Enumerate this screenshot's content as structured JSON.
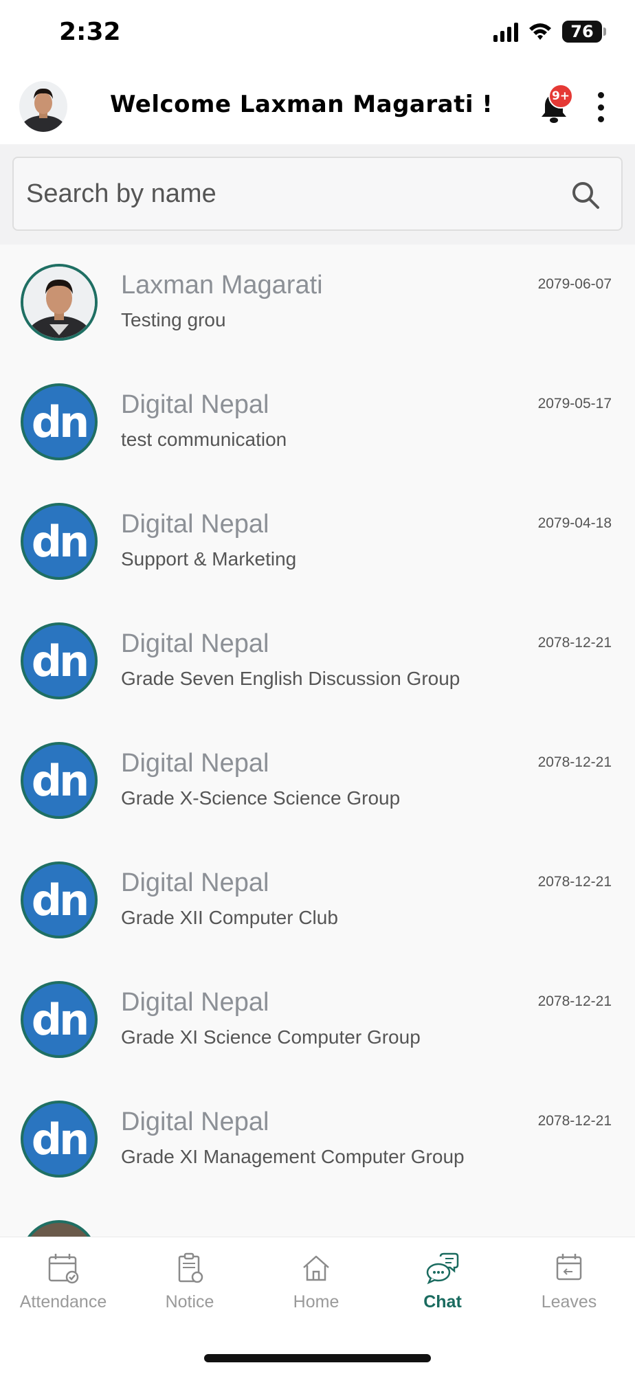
{
  "status_bar": {
    "time": "2:32",
    "battery": "76"
  },
  "header": {
    "welcome_text": "Welcome Laxman Magarati !",
    "notification_badge": "9+"
  },
  "search": {
    "placeholder": "Search by name"
  },
  "colors": {
    "accent": "#1a6b5f",
    "dn_blue": "#2a75c0",
    "badge_red": "#e53935"
  },
  "chats": [
    {
      "name": "Laxman Magarati",
      "message": "Testing grou",
      "date": "2079-06-07",
      "avatar": "photo"
    },
    {
      "name": "Digital Nepal",
      "message": "test communication",
      "date": "2079-05-17",
      "avatar": "dn"
    },
    {
      "name": "Digital Nepal",
      "message": "Support & Marketing",
      "date": "2079-04-18",
      "avatar": "dn"
    },
    {
      "name": "Digital Nepal",
      "message": "Grade Seven English Discussion Group",
      "date": "2078-12-21",
      "avatar": "dn"
    },
    {
      "name": "Digital Nepal",
      "message": "Grade X-Science Science Group",
      "date": "2078-12-21",
      "avatar": "dn"
    },
    {
      "name": "Digital Nepal",
      "message": "Grade XII Computer Club",
      "date": "2078-12-21",
      "avatar": "dn"
    },
    {
      "name": "Digital Nepal",
      "message": "Grade XI Science Computer Group",
      "date": "2078-12-21",
      "avatar": "dn"
    },
    {
      "name": "Digital Nepal",
      "message": "Grade XI Management Computer Group",
      "date": "2078-12-21",
      "avatar": "dn"
    }
  ],
  "avatar_logo_text": "dn",
  "bottom_nav": [
    {
      "label": "Attendance",
      "icon": "calendar-check-icon",
      "active": false
    },
    {
      "label": "Notice",
      "icon": "notice-board-icon",
      "active": false
    },
    {
      "label": "Home",
      "icon": "home-icon",
      "active": false
    },
    {
      "label": "Chat",
      "icon": "chat-bubbles-icon",
      "active": true
    },
    {
      "label": "Leaves",
      "icon": "calendar-leave-icon",
      "active": false
    }
  ]
}
